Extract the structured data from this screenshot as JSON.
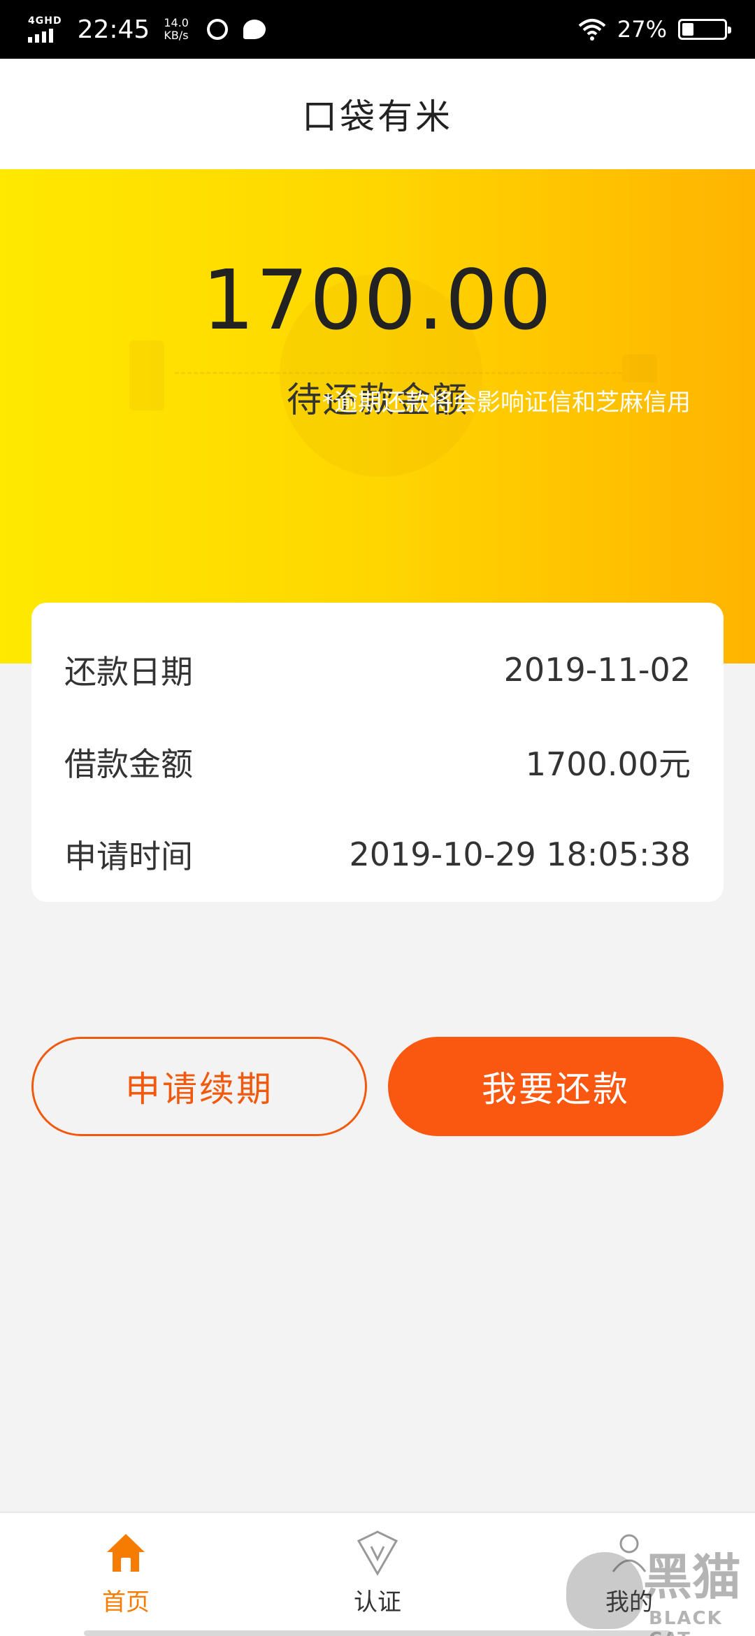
{
  "status_bar": {
    "network": "4GHD",
    "time": "22:45",
    "speed_value": "14.0",
    "speed_unit": "KB/s",
    "battery_percent": "27%",
    "battery_level": 0.27
  },
  "header": {
    "title": "口袋有米"
  },
  "hero": {
    "amount": "1700.00",
    "label": "待还款金额",
    "note": "*逾期还款将会影响证信和芝麻信用"
  },
  "details": [
    {
      "label": "还款日期",
      "value": "2019-11-02"
    },
    {
      "label": "借款金额",
      "value": "1700.00元"
    },
    {
      "label": "申请时间",
      "value": "2019-10-29 18:05:38"
    }
  ],
  "actions": {
    "renew_label": "申请续期",
    "repay_label": "我要还款"
  },
  "bottom_nav": [
    {
      "label": "首页",
      "icon": "home-icon",
      "active": true
    },
    {
      "label": "认证",
      "icon": "verify-icon",
      "active": false
    },
    {
      "label": "我的",
      "icon": "profile-icon",
      "active": false
    }
  ],
  "watermark": {
    "text": "黑猫",
    "subtext": "BLACK CAT"
  },
  "colors": {
    "accent_orange": "#fa5710",
    "hero_yellow": "#ffe900",
    "nav_active": "#f57c00"
  }
}
